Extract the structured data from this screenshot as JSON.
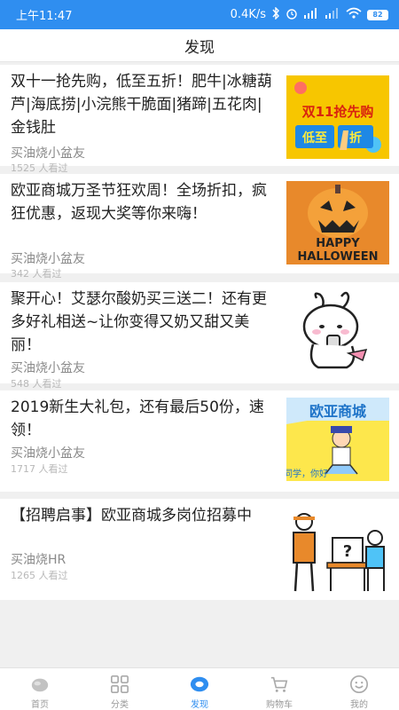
{
  "status": {
    "time": "上午11:47",
    "speed": "0.4K/s",
    "battery": "82"
  },
  "header": {
    "title": "发现"
  },
  "articles": [
    {
      "title": "双十一抢先购，低至五折！肥牛|冰糖葫芦|海底捞|小浣熊干脆面|猪蹄|五花肉|金钱肚",
      "author": "买油烧小盆友",
      "views": "1525 人看过",
      "thumb_text_1": "双11抢先购",
      "thumb_text_2": "低至",
      "thumb_text_3": "折"
    },
    {
      "title": "欧亚商城万圣节狂欢周！全场折扣，疯狂优惠，返现大奖等你来嗨！",
      "author": "买油烧小盆友",
      "views": "342 人看过",
      "thumb_text_1": "HAPPY",
      "thumb_text_2": "HALLOWEEN"
    },
    {
      "title": "聚开心！艾瑟尔酸奶买三送二！还有更多好礼相送~让你变得又奶又甜又美丽！",
      "author": "买油烧小盆友",
      "views": "548 人看过"
    },
    {
      "title": "2019新生大礼包，还有最后50份，速领！",
      "author": "买油烧小盆友",
      "views": "1717 人看过",
      "thumb_text_1": "欧亚商城",
      "thumb_text_2": "同学，你好"
    },
    {
      "title": "【招聘启事】欧亚商城多岗位招募中",
      "author": "买油烧HR",
      "views": "1265 人看过",
      "thumb_text_1": "?"
    }
  ],
  "tabs": [
    {
      "label": "首页",
      "icon": "home-icon"
    },
    {
      "label": "分类",
      "icon": "grid-icon"
    },
    {
      "label": "发现",
      "icon": "discover-icon"
    },
    {
      "label": "购物车",
      "icon": "cart-icon"
    },
    {
      "label": "我的",
      "icon": "profile-icon"
    }
  ],
  "colors": {
    "primary": "#2f8ef0",
    "inactive": "#999999"
  }
}
